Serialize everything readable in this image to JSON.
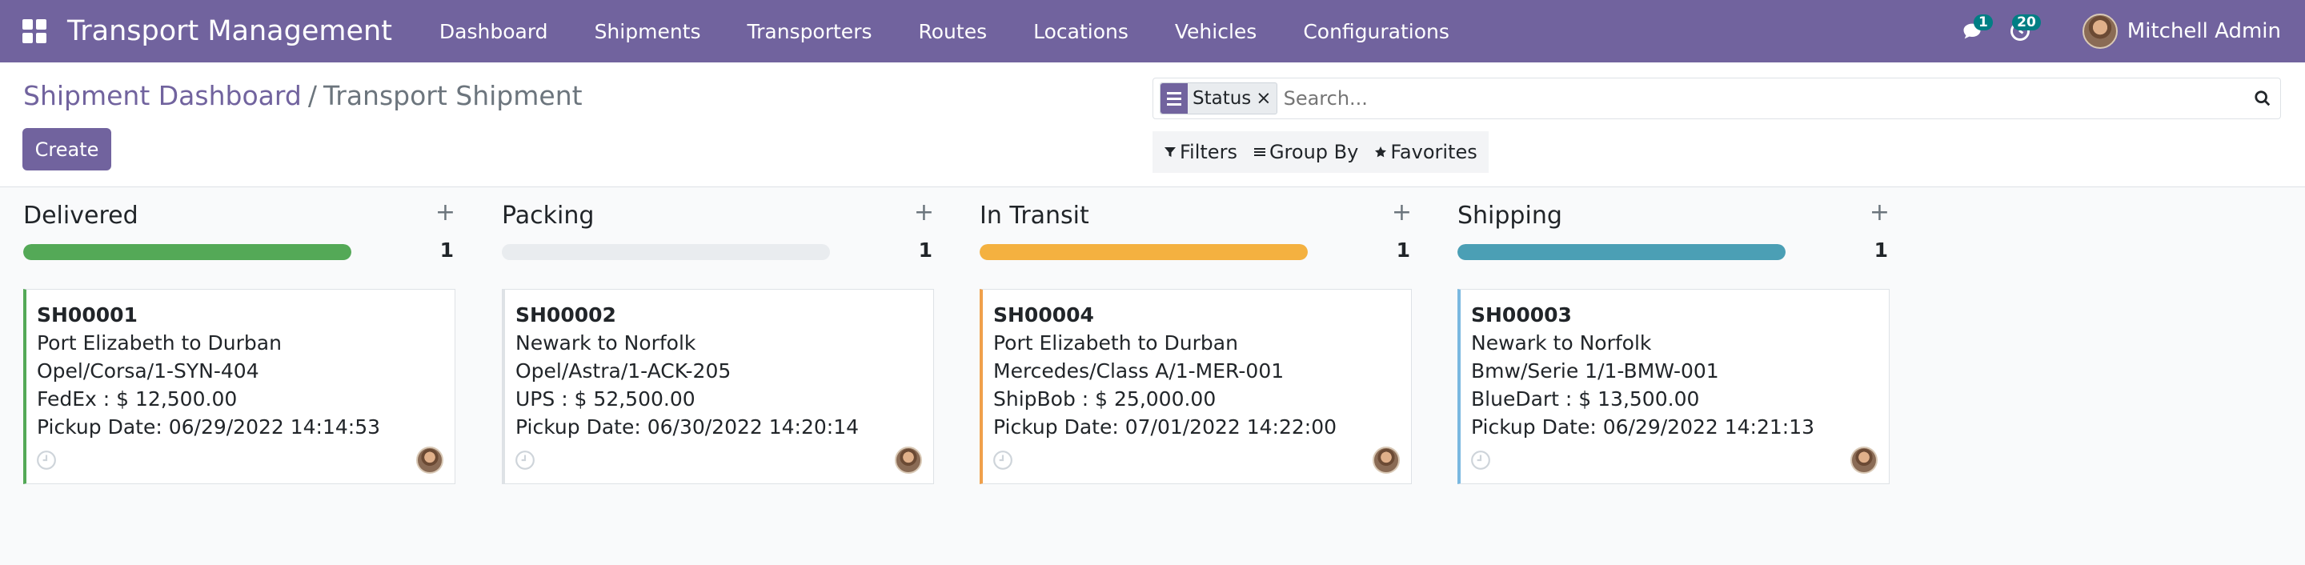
{
  "navbar": {
    "brand": "Transport Management",
    "menu": [
      "Dashboard",
      "Shipments",
      "Transporters",
      "Routes",
      "Locations",
      "Vehicles",
      "Configurations"
    ],
    "messages_count": "1",
    "activities_count": "20",
    "user_name": "Mitchell Admin"
  },
  "control": {
    "breadcrumb_parent": "Shipment Dashboard",
    "breadcrumb_separator": "/",
    "breadcrumb_current": "Transport Shipment",
    "create_label": "Create",
    "facet_label": "Status",
    "facet_remove": "×",
    "search_placeholder": "Search...",
    "filters_label": "Filters",
    "groupby_label": "Group By",
    "favorites_label": "Favorites"
  },
  "columns": [
    {
      "title": "Delivered",
      "add": "+",
      "count": "1",
      "progress_fraction": 1.0,
      "color": "#54a957",
      "card": {
        "ref": "SH00001",
        "route": "Port Elizabeth to Durban",
        "vehicle": "Opel/Corsa/1-SYN-404",
        "carrier_cost": "FedEx : $ 12,500.00",
        "pickup": "Pickup Date: 06/29/2022 14:14:53"
      }
    },
    {
      "title": "Packing",
      "add": "+",
      "count": "1",
      "progress_fraction": 0.0,
      "color": "#dee2e6",
      "card": {
        "ref": "SH00002",
        "route": "Newark to Norfolk",
        "vehicle": "Opel/Astra/1-ACK-205",
        "carrier_cost": "UPS : $ 52,500.00",
        "pickup": "Pickup Date: 06/30/2022 14:20:14"
      }
    },
    {
      "title": "In Transit",
      "add": "+",
      "count": "1",
      "progress_fraction": 1.0,
      "color": "#f4b140",
      "card": {
        "ref": "SH00004",
        "route": "Port Elizabeth to Durban",
        "vehicle": "Mercedes/Class A/1-MER-001",
        "carrier_cost": "ShipBob : $ 25,000.00",
        "pickup": "Pickup Date: 07/01/2022 14:22:00"
      }
    },
    {
      "title": "Shipping",
      "add": "+",
      "count": "1",
      "progress_fraction": 1.0,
      "color": "#4b9fb5",
      "card": {
        "ref": "SH00003",
        "route": "Newark to Norfolk",
        "vehicle": "Bmw/Serie 1/1-BMW-001",
        "carrier_cost": "BlueDart : $ 13,500.00",
        "pickup": "Pickup Date: 06/29/2022 14:21:13"
      }
    }
  ],
  "card_border_colors": [
    "#54a957",
    "#dee2e6",
    "#f0a04b",
    "#7ab8e0"
  ],
  "icons": {
    "apps": "apps-grid-icon",
    "chat": "chat-icon",
    "activity": "clock-icon",
    "search": "search-icon",
    "filter": "funnel-icon",
    "groupby": "list-icon",
    "favorites": "star-icon"
  }
}
